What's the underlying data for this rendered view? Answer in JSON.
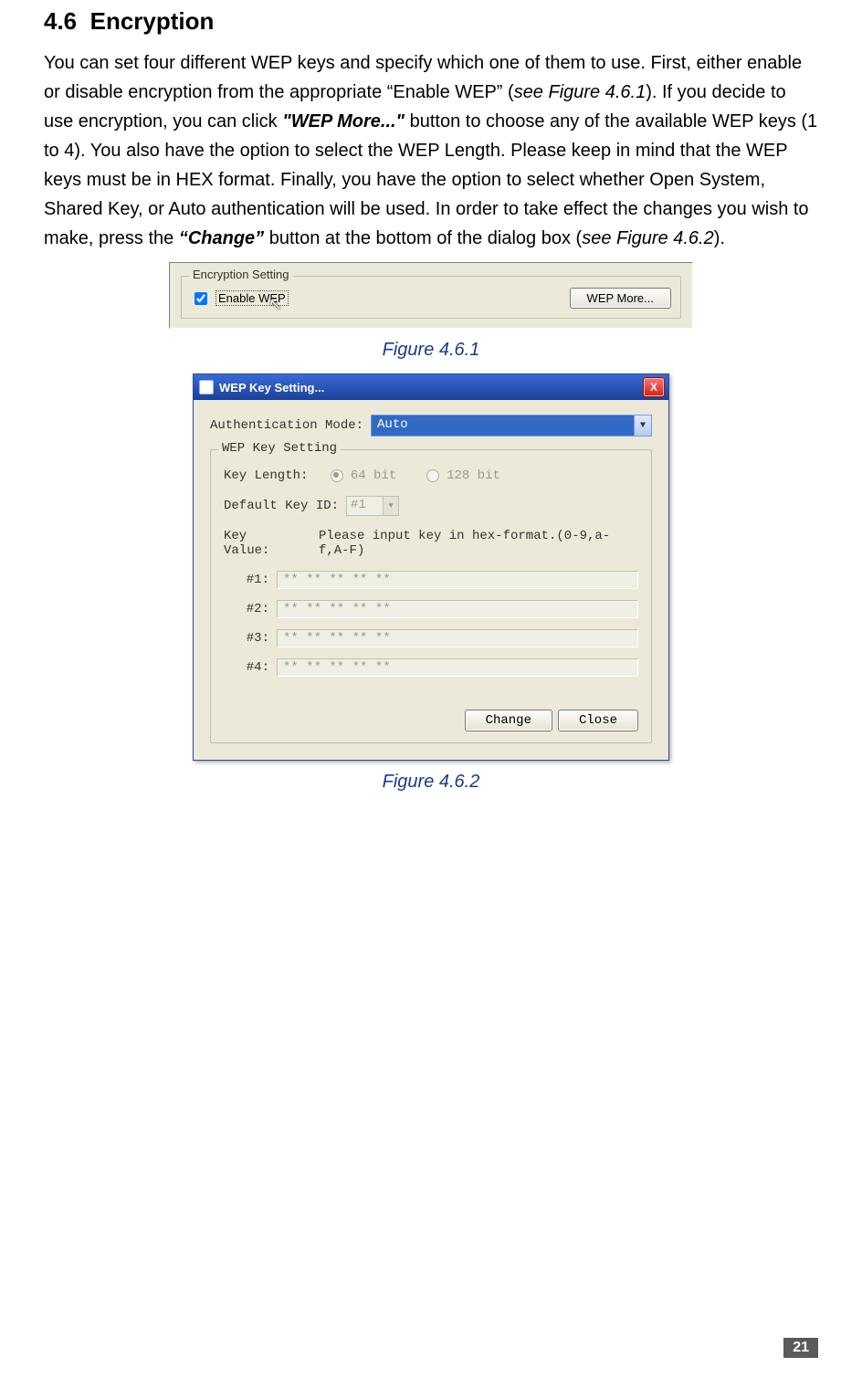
{
  "section": {
    "number": "4.6",
    "title": "Encryption"
  },
  "paragraph": {
    "p1": "You can set four different WEP keys and specify which one of them to use. First, either enable or disable encryption from the appropriate “Enable WEP” (",
    "see461": "see Figure 4.6.1",
    "p2": "). If you decide to use encryption, you can click ",
    "wepmore": "\"WEP More...\"",
    "p3": " button to choose any of the available WEP keys (1 to 4). You also have the option to select the WEP Length. Please keep in mind that the WEP keys must be in HEX format. Finally, you have the option to select whether Open System, Shared Key, or Auto authentication will be used. In order to take effect the changes you wish to make, press the ",
    "change": "“Change”",
    "p4": " button at the bottom of the dialog box (",
    "see462": "see Figure 4.6.2",
    "p5": ")."
  },
  "fig461": {
    "caption": "Figure 4.6.1",
    "group_label": "Encryption Setting",
    "enable_label": "Enable WEP",
    "wepmore_btn": "WEP More..."
  },
  "fig462": {
    "caption": "Figure 4.6.2",
    "title": "WEP Key Setting...",
    "auth_label": "Authentication Mode:",
    "auth_value": "Auto",
    "group_label": "WEP Key Setting",
    "key_length_label": "Key Length:",
    "radio1": "64 bit",
    "radio2": "128 bit",
    "default_id_label": "Default Key ID:",
    "default_id_value": "#1",
    "key_value_label": "Key Value:",
    "key_value_hint": "Please input key in hex-format.(0-9,a-f,A-F)",
    "keys": {
      "k1_label": "#1:",
      "k2_label": "#2:",
      "k3_label": "#3:",
      "k4_label": "#4:",
      "mask": "** ** ** ** **"
    },
    "change_btn": "Change",
    "close_btn": "Close"
  },
  "page_number": "21"
}
